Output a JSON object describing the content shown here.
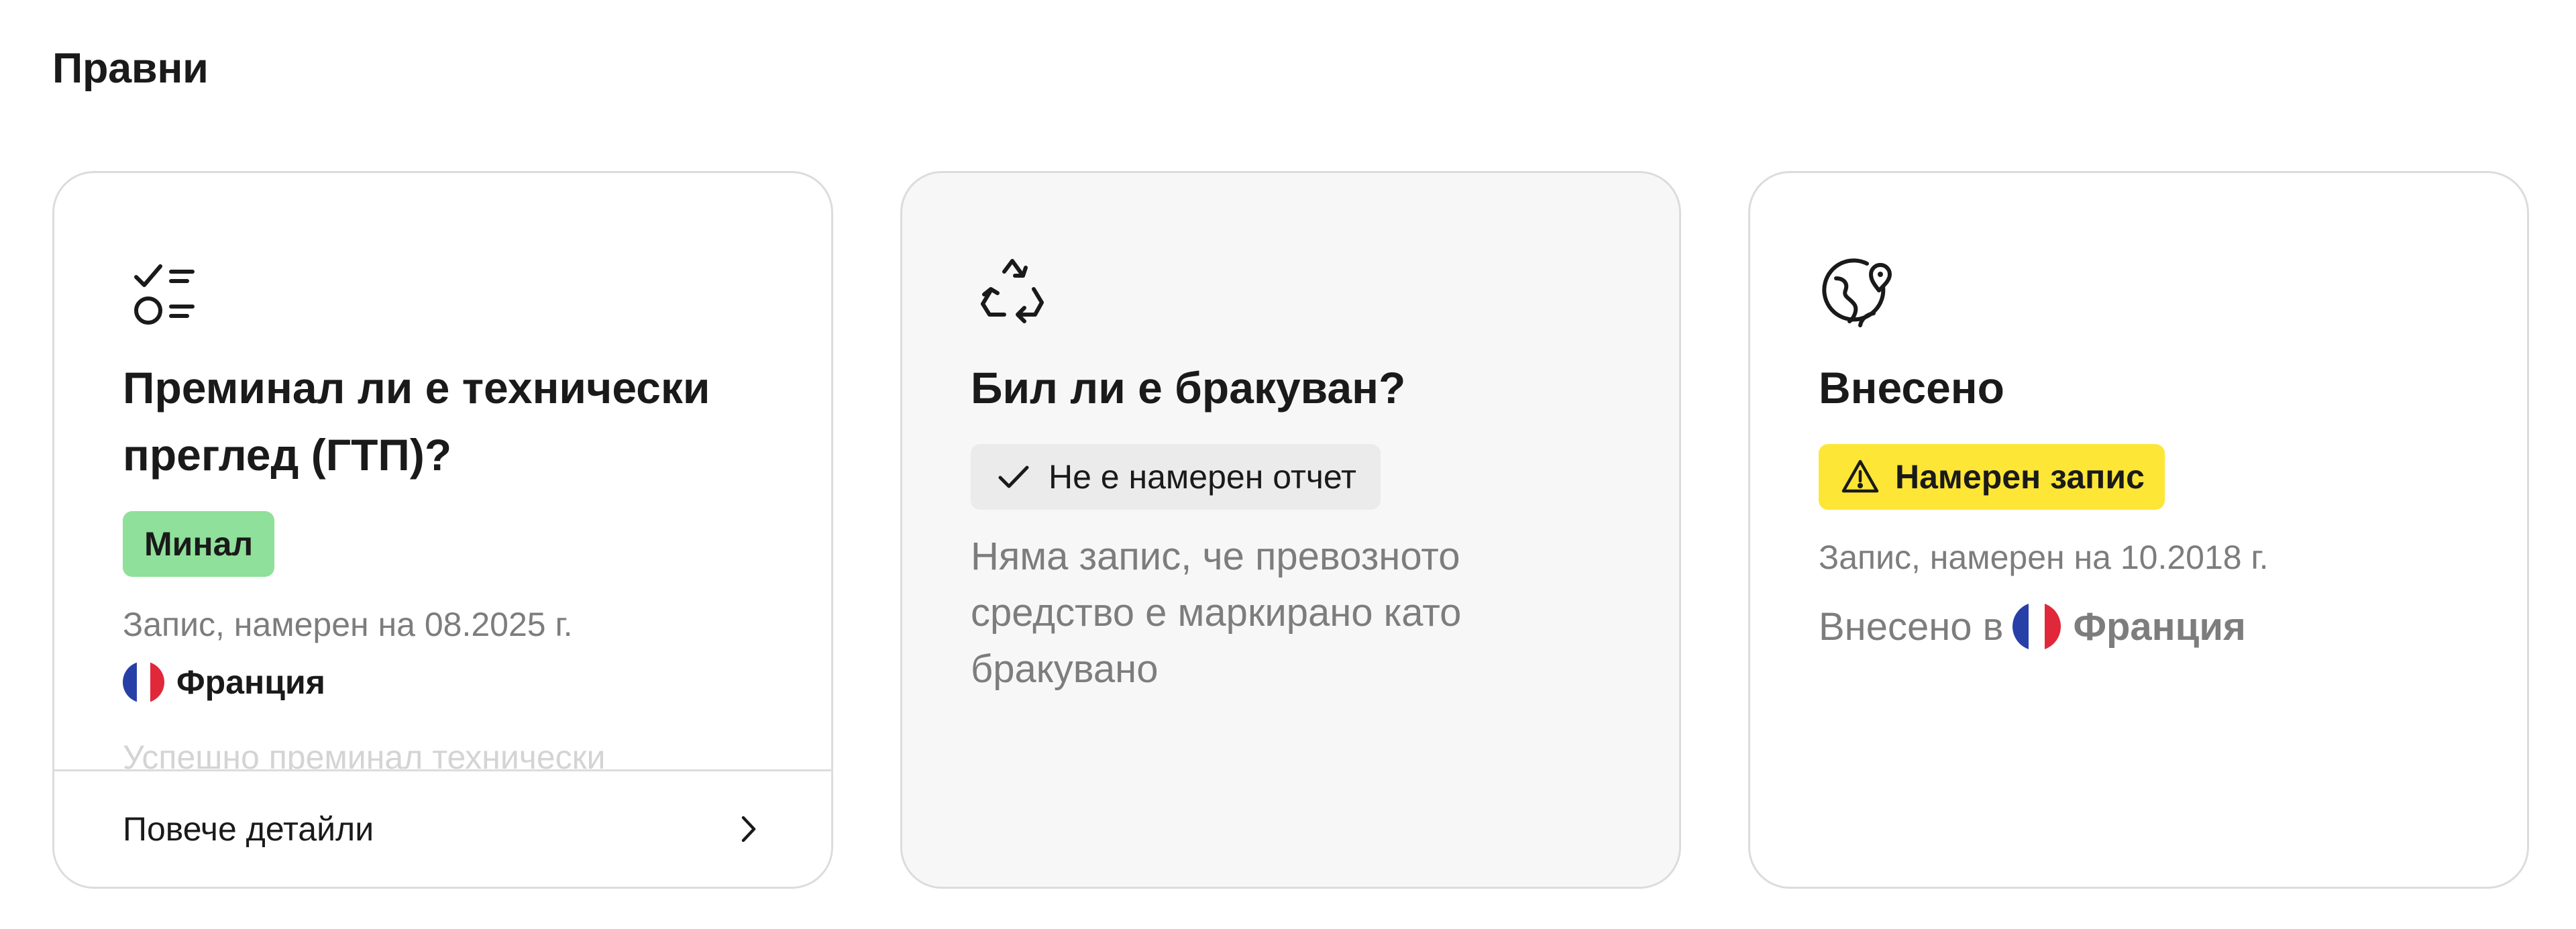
{
  "section": {
    "title": "Правни"
  },
  "cards": [
    {
      "icon": "checklist-icon",
      "title_line1": "Преминал ли е технически",
      "title_line2": "преглед (ГТП)?",
      "badge": "Минал",
      "record": "Запис, намерен на 08.2025 г.",
      "country": "Франция",
      "faded_text": "Успешно преминал технически",
      "footer_label": "Повече детайли"
    },
    {
      "icon": "recycle-icon",
      "title": "Бил ли е бракуван?",
      "badge": "Не е намерен отчет",
      "description": "Няма запис, че превозното средство е маркирано като бракувано"
    },
    {
      "icon": "globe-location-icon",
      "title": "Внесено",
      "badge": "Намерен запис",
      "record": "Запис, намерен на 10.2018 г.",
      "registered_prefix": "Внесено в",
      "country": "Франция"
    }
  ],
  "colors": {
    "pass_badge": "#8fe09a",
    "neutral_badge": "#ebebeb",
    "warning_badge": "#fde636",
    "card_border": "#dcdcdc",
    "muted_text": "#7d7d7d"
  }
}
